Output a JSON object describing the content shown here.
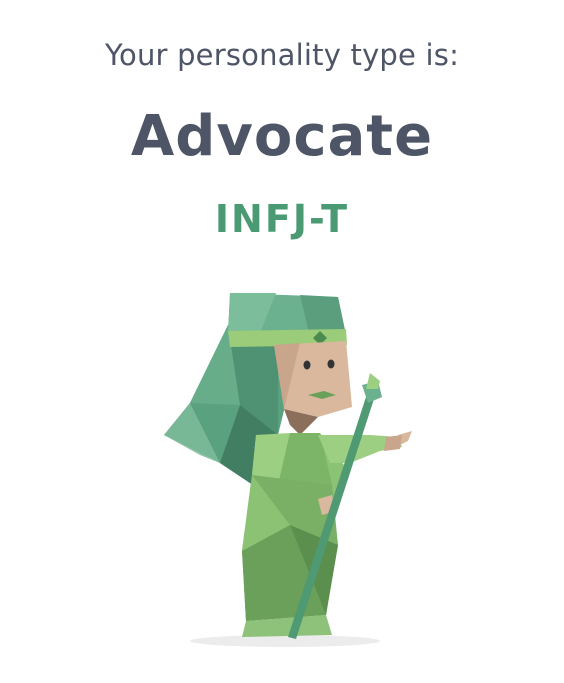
{
  "result": {
    "intro": "Your personality type is:",
    "type_name": "Advocate",
    "type_code": "INFJ-T"
  },
  "colors": {
    "heading": "#4d5566",
    "accent_green": "#4a9b73",
    "background": "#ffffff"
  },
  "illustration": {
    "icon": "advocate-character-icon"
  }
}
